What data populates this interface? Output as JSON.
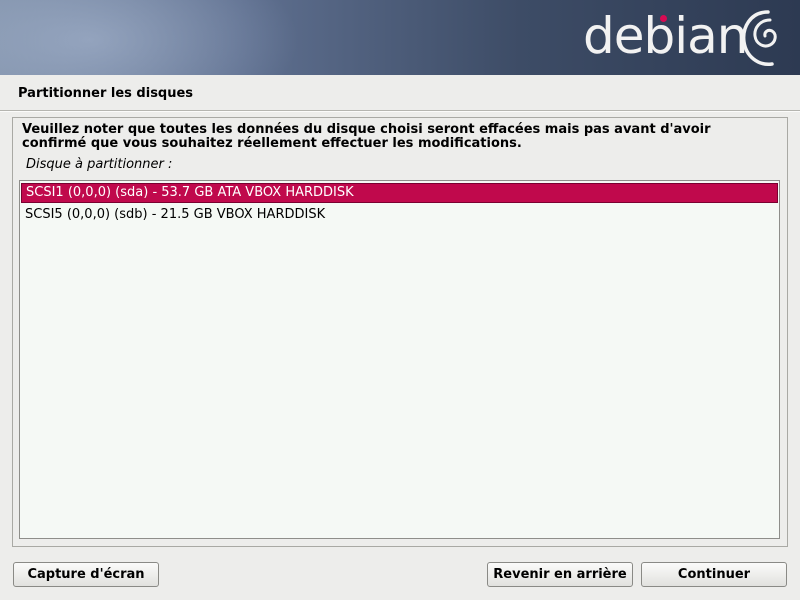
{
  "banner": {
    "logo_text": "debian",
    "accent_color": "#d70a53"
  },
  "page": {
    "title": "Partitionner les disques"
  },
  "main": {
    "intro": "Veuillez noter que toutes les données du disque choisi seront effacées mais pas avant d'avoir confirmé que vous souhaitez réellement effectuer les modifications.",
    "list_label": "Disque à partitionner :",
    "disks": [
      {
        "label": "SCSI1 (0,0,0) (sda) - 53.7 GB ATA VBOX HARDDISK",
        "selected": true
      },
      {
        "label": "SCSI5 (0,0,0) (sdb) - 21.5 GB VBOX HARDDISK",
        "selected": false
      }
    ],
    "selection_color": "#c0094c"
  },
  "buttons": {
    "screenshot": "Capture d'écran",
    "back": "Revenir en arrière",
    "continue": "Continuer"
  }
}
